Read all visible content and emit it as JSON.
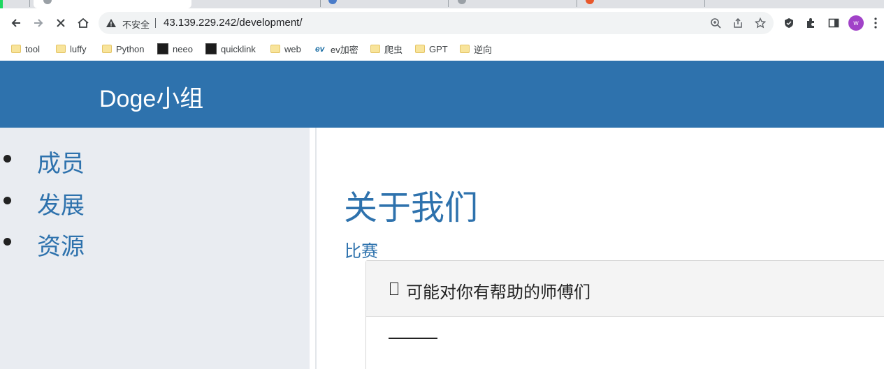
{
  "browser": {
    "address_bar": {
      "security_label": "不安全",
      "url": "43.139.229.242/development/"
    },
    "avatar_letter": "w",
    "bookmarks": [
      {
        "label": "tool",
        "icon": "folder-icon"
      },
      {
        "label": "luffy",
        "icon": "folder-icon"
      },
      {
        "label": "Python",
        "icon": "folder-icon"
      },
      {
        "label": "neeo",
        "icon": "site-icon"
      },
      {
        "label": "quicklink",
        "icon": "site-icon"
      },
      {
        "label": "web",
        "icon": "folder-icon"
      },
      {
        "label": "ev加密",
        "icon": "ev-site-icon"
      },
      {
        "label": "爬虫",
        "icon": "folder-icon"
      },
      {
        "label": "GPT",
        "icon": "folder-icon"
      },
      {
        "label": "逆向",
        "icon": "folder-icon"
      }
    ]
  },
  "page": {
    "brand": "Doge小组",
    "sidebar": {
      "items": [
        {
          "label": "成员"
        },
        {
          "label": "发展"
        },
        {
          "label": "资源"
        }
      ]
    },
    "main": {
      "title": "关于我们",
      "subtitle": "比赛",
      "card": {
        "title": "可能对你有帮助的师傅们"
      }
    }
  },
  "colors": {
    "header_bg": "#2e72ad",
    "link": "#2e72ad",
    "sidebar_bg": "#e9ecf1",
    "accent_edge": "#1ed760"
  }
}
